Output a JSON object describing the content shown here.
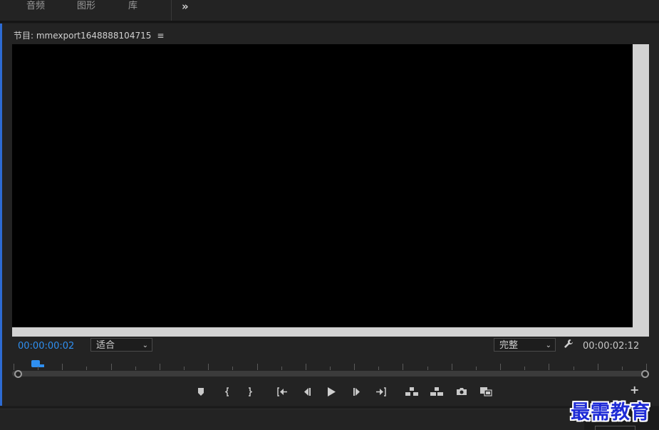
{
  "workspace_tabs": [
    {
      "label": "音频"
    },
    {
      "label": "图形"
    },
    {
      "label": "库"
    }
  ],
  "overflow_label": "»",
  "panel": {
    "title": "节目: mmexport1648888104715",
    "menu_glyph": "≡"
  },
  "timecode": {
    "current": "00:00:00:02",
    "duration": "00:00:02:12"
  },
  "zoom_select": {
    "selected": "适合"
  },
  "quality_select": {
    "selected": "完整"
  },
  "playhead_position_fraction": 0.03,
  "controls": [
    {
      "name": "add-marker-button",
      "icon": "marker-icon"
    },
    {
      "name": "mark-in-button",
      "icon": "mark-in-icon"
    },
    {
      "name": "mark-out-button",
      "icon": "mark-out-icon"
    },
    {
      "name": "go-to-in-button",
      "icon": "go-to-in-icon"
    },
    {
      "name": "step-back-button",
      "icon": "step-back-icon"
    },
    {
      "name": "play-button",
      "icon": "play-icon"
    },
    {
      "name": "step-forward-button",
      "icon": "step-forward-icon"
    },
    {
      "name": "go-to-out-button",
      "icon": "go-to-out-icon"
    },
    {
      "name": "lift-button",
      "icon": "lift-icon"
    },
    {
      "name": "extract-button",
      "icon": "extract-icon"
    },
    {
      "name": "export-frame-button",
      "icon": "camera-icon"
    },
    {
      "name": "comparison-view-button",
      "icon": "comparison-icon"
    }
  ],
  "watermark": "最需教育",
  "colors": {
    "accent": "#2f8ff0",
    "panel_bg": "#232323",
    "viewer_bg": "#000000"
  }
}
